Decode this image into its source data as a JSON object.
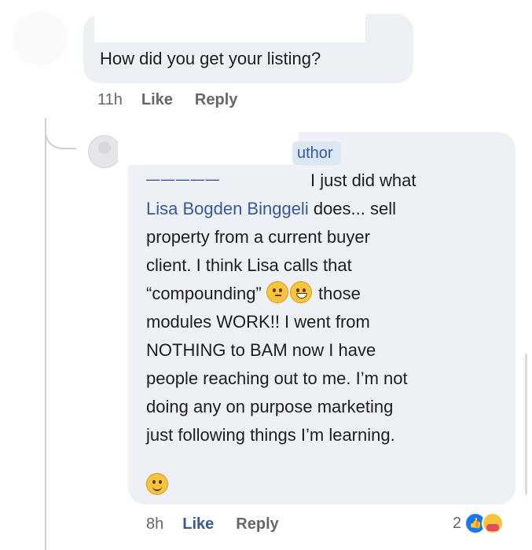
{
  "parent_comment": {
    "text": "How did you get your listing?",
    "time": "11h",
    "like_label": "Like",
    "reply_label": "Reply"
  },
  "reply_comment": {
    "author_badge": "uthor",
    "first_line": "I just did what",
    "mention": "Lisa Bogden Binggeli",
    "line2_rest": " does... sell",
    "lines": [
      "property from a current buyer",
      "client. I think Lisa calls that"
    ],
    "compounding": "“compounding”",
    "those": " those",
    "lines_after": [
      "modules WORK!! I went from",
      "NOTHING to BAM now I have",
      "people reaching out to me. I’m not",
      "doing any on purpose marketing",
      "just following things I’m learning."
    ],
    "time": "8h",
    "like_label": "Like",
    "reply_label": "Reply",
    "reaction_count": "2"
  }
}
